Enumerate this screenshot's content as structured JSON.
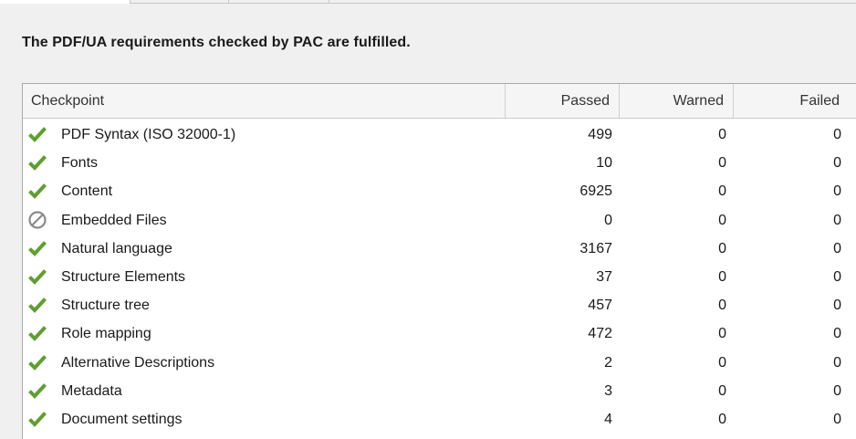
{
  "summary": "The PDF/UA requirements checked by PAC are fulfilled.",
  "colors": {
    "pass": "#5f9e2f",
    "na": "#8a8a8a"
  },
  "columns": {
    "checkpoint": "Checkpoint",
    "passed": "Passed",
    "warned": "Warned",
    "failed": "Failed"
  },
  "rows": [
    {
      "icon": "check-icon",
      "label": "PDF Syntax (ISO 32000-1)",
      "passed": "499",
      "warned": "0",
      "failed": "0"
    },
    {
      "icon": "check-icon",
      "label": "Fonts",
      "passed": "10",
      "warned": "0",
      "failed": "0"
    },
    {
      "icon": "check-icon",
      "label": "Content",
      "passed": "6925",
      "warned": "0",
      "failed": "0"
    },
    {
      "icon": "not-applicable-icon",
      "label": "Embedded Files",
      "passed": "0",
      "warned": "0",
      "failed": "0"
    },
    {
      "icon": "check-icon",
      "label": "Natural language",
      "passed": "3167",
      "warned": "0",
      "failed": "0"
    },
    {
      "icon": "check-icon",
      "label": "Structure Elements",
      "passed": "37",
      "warned": "0",
      "failed": "0"
    },
    {
      "icon": "check-icon",
      "label": "Structure tree",
      "passed": "457",
      "warned": "0",
      "failed": "0"
    },
    {
      "icon": "check-icon",
      "label": "Role mapping",
      "passed": "472",
      "warned": "0",
      "failed": "0"
    },
    {
      "icon": "check-icon",
      "label": "Alternative Descriptions",
      "passed": "2",
      "warned": "0",
      "failed": "0"
    },
    {
      "icon": "check-icon",
      "label": "Metadata",
      "passed": "3",
      "warned": "0",
      "failed": "0"
    },
    {
      "icon": "check-icon",
      "label": "Document settings",
      "passed": "4",
      "warned": "0",
      "failed": "0"
    }
  ]
}
